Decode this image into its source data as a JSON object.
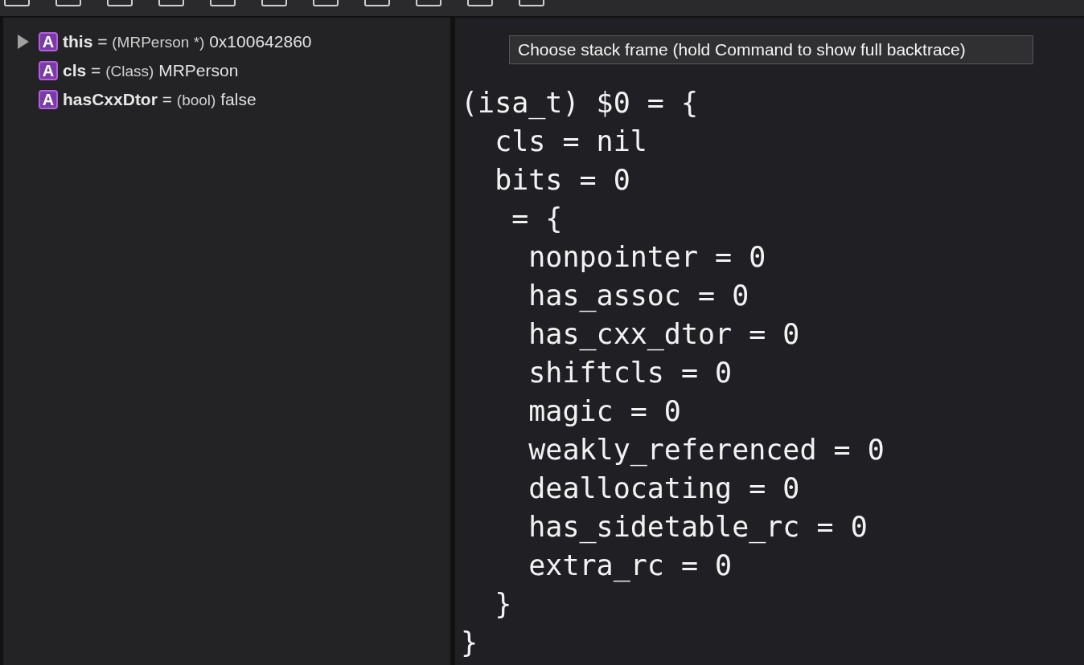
{
  "variables": [
    {
      "badge": "A",
      "name": "this",
      "separator": "=",
      "type": "(MRPerson *)",
      "value": "0x100642860",
      "expandable": true
    },
    {
      "badge": "A",
      "name": "cls",
      "separator": "=",
      "type": "(Class)",
      "value": "MRPerson",
      "expandable": false
    },
    {
      "badge": "A",
      "name": "hasCxxDtor",
      "separator": "=",
      "type": "(bool)",
      "value": "false",
      "expandable": false
    }
  ],
  "console": {
    "output": [
      "(isa_t) $0 = {",
      "  cls = nil",
      "  bits = 0",
      "   = {",
      "    nonpointer = 0",
      "    has_assoc = 0",
      "    has_cxx_dtor = 0",
      "    shiftcls = 0",
      "    magic = 0",
      "    weakly_referenced = 0",
      "    deallocating = 0",
      "    has_sidetable_rc = 0",
      "    extra_rc = 0",
      "  }",
      "}"
    ]
  },
  "tooltip": "Choose stack frame (hold Command to show full backtrace)"
}
